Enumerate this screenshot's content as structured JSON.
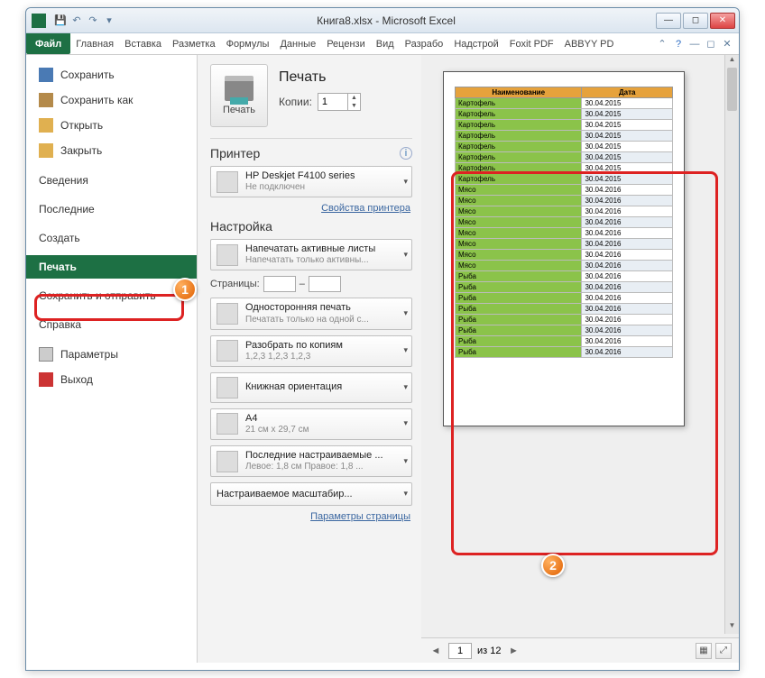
{
  "window": {
    "title": "Книга8.xlsx - Microsoft Excel"
  },
  "qat": {
    "save": "💾",
    "undo": "↶",
    "redo": "↷",
    "more": "▾"
  },
  "ribbon": {
    "file": "Файл",
    "tabs": [
      "Главная",
      "Вставка",
      "Разметка",
      "Формулы",
      "Данные",
      "Рецензи",
      "Вид",
      "Разрабо",
      "Надстрой",
      "Foxit PDF",
      "ABBYY PD"
    ]
  },
  "backstage": {
    "save": "Сохранить",
    "save_as": "Сохранить как",
    "open": "Открыть",
    "close": "Закрыть",
    "info": "Сведения",
    "recent": "Последние",
    "new": "Создать",
    "print": "Печать",
    "share": "Сохранить и отправить",
    "help": "Справка",
    "options": "Параметры",
    "exit": "Выход"
  },
  "print": {
    "title": "Печать",
    "button": "Печать",
    "copies_label": "Копии:",
    "copies_value": "1",
    "printer_heading": "Принтер",
    "printer_name": "HP Deskjet F4100 series",
    "printer_status": "Не подключен",
    "printer_props": "Свойства принтера",
    "settings_heading": "Настройка",
    "active_sheets": "Напечатать активные листы",
    "active_sheets_sub": "Напечатать только активны...",
    "pages_label": "Страницы:",
    "pages_sep": "–",
    "one_side": "Односторонняя печать",
    "one_side_sub": "Печатать только на одной с...",
    "collate": "Разобрать по копиям",
    "collate_sub": "1,2,3   1,2,3   1,2,3",
    "orientation": "Книжная ориентация",
    "paper": "A4",
    "paper_sub": "21 см x 29,7 см",
    "margins": "Последние настраиваемые ...",
    "margins_sub": "Левое: 1,8 см   Правое: 1,8 ...",
    "scaling": "Настраиваемое масштабир...",
    "page_setup": "Параметры страницы"
  },
  "preview": {
    "nav_current": "1",
    "nav_total": "из 12",
    "headers": {
      "name": "Наименование",
      "date": "Дата"
    },
    "rows": [
      {
        "n": "Картофель",
        "d": "30.04.2015"
      },
      {
        "n": "Картофель",
        "d": "30.04.2015"
      },
      {
        "n": "Картофель",
        "d": "30.04.2015"
      },
      {
        "n": "Картофель",
        "d": "30.04.2015"
      },
      {
        "n": "Картофель",
        "d": "30.04.2015"
      },
      {
        "n": "Картофель",
        "d": "30.04.2015"
      },
      {
        "n": "Картофель",
        "d": "30.04.2015"
      },
      {
        "n": "Картофель",
        "d": "30.04.2015"
      },
      {
        "n": "Мясо",
        "d": "30.04.2016"
      },
      {
        "n": "Мясо",
        "d": "30.04.2016"
      },
      {
        "n": "Мясо",
        "d": "30.04.2016"
      },
      {
        "n": "Мясо",
        "d": "30.04.2016"
      },
      {
        "n": "Мясо",
        "d": "30.04.2016"
      },
      {
        "n": "Мясо",
        "d": "30.04.2016"
      },
      {
        "n": "Мясо",
        "d": "30.04.2016"
      },
      {
        "n": "Мясо",
        "d": "30.04.2016"
      },
      {
        "n": "Рыба",
        "d": "30.04.2016"
      },
      {
        "n": "Рыба",
        "d": "30.04.2016"
      },
      {
        "n": "Рыба",
        "d": "30.04.2016"
      },
      {
        "n": "Рыба",
        "d": "30.04.2016"
      },
      {
        "n": "Рыба",
        "d": "30.04.2016"
      },
      {
        "n": "Рыба",
        "d": "30.04.2016"
      },
      {
        "n": "Рыба",
        "d": "30.04.2016"
      },
      {
        "n": "Рыба",
        "d": "30.04.2016"
      }
    ]
  },
  "badges": {
    "one": "1",
    "two": "2"
  }
}
